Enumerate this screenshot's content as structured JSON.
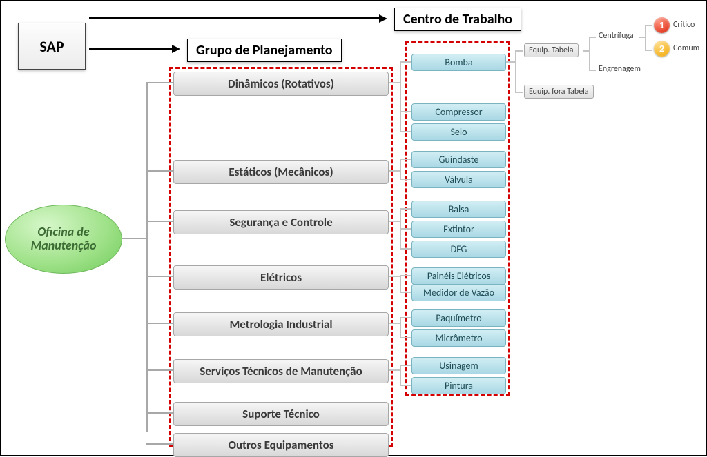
{
  "sap": "SAP",
  "headers": {
    "centro": "Centro de Trabalho",
    "grupo": "Grupo de Planejamento"
  },
  "root": "Oficina de\nManutenção",
  "planning_groups": [
    "Dinâmicos (Rotativos)",
    "Estáticos (Mecânicos)",
    "Segurança e Controle",
    "Elétricos",
    "Metrologia Industrial",
    "Serviços Técnicos de Manutenção",
    "Suporte Técnico",
    "Outros Equipamentos"
  ],
  "work_centers": [
    "Bomba",
    "Compressor",
    "Selo",
    "Guindaste",
    "Válvula",
    "Balsa",
    "Extintor",
    "DFG",
    "Painéis Elétricos",
    "Medidor de Vazão",
    "Paquímetro",
    "Micrômetro",
    "Usinagem",
    "Pintura"
  ],
  "equip": {
    "tabela": "Equip. Tabela",
    "fora": "Equip. fora Tabela"
  },
  "leaves": {
    "centrifuga": "Centrífuga",
    "engrenagem": "Engrenagem"
  },
  "priority": {
    "critico": "Crítico",
    "comum": "Comum"
  },
  "icons": {
    "one": "1",
    "two": "2"
  }
}
